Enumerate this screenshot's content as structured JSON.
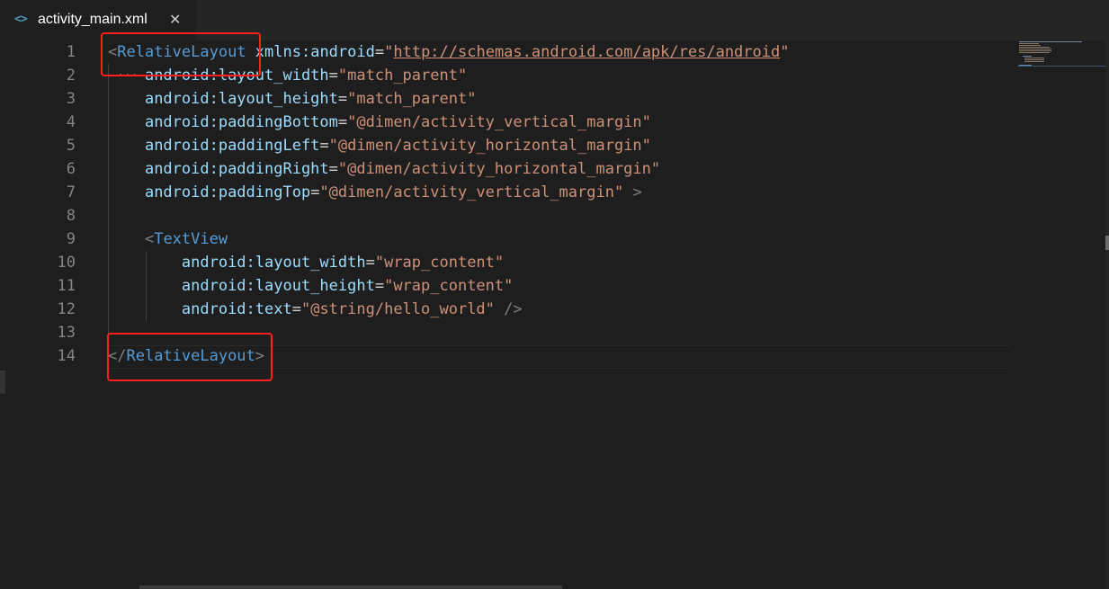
{
  "tab": {
    "icon": "xml-code-icon",
    "icon_glyph": "<>",
    "title": "activity_main.xml",
    "close_glyph": "✕"
  },
  "lines": [
    {
      "num": "1",
      "tokens": [
        [
          "br",
          "<"
        ],
        [
          "tag",
          "RelativeLayout"
        ],
        [
          "eq",
          " "
        ],
        [
          "attr",
          "xmlns:android"
        ],
        [
          "eq",
          "="
        ],
        [
          "str",
          "\""
        ],
        [
          "url",
          "http://schemas.android.com/apk/res/android"
        ],
        [
          "str",
          "\""
        ]
      ]
    },
    {
      "num": "2",
      "tokens": [
        [
          "eq",
          "    "
        ],
        [
          "attr",
          "android:layout_width"
        ],
        [
          "eq",
          "="
        ],
        [
          "str",
          "\"match_parent\""
        ]
      ]
    },
    {
      "num": "3",
      "tokens": [
        [
          "eq",
          "    "
        ],
        [
          "attr",
          "android:layout_height"
        ],
        [
          "eq",
          "="
        ],
        [
          "str",
          "\"match_parent\""
        ]
      ]
    },
    {
      "num": "4",
      "tokens": [
        [
          "eq",
          "    "
        ],
        [
          "attr",
          "android:paddingBottom"
        ],
        [
          "eq",
          "="
        ],
        [
          "str",
          "\"@dimen/activity_vertical_margin\""
        ]
      ]
    },
    {
      "num": "5",
      "tokens": [
        [
          "eq",
          "    "
        ],
        [
          "attr",
          "android:paddingLeft"
        ],
        [
          "eq",
          "="
        ],
        [
          "str",
          "\"@dimen/activity_horizontal_margin\""
        ]
      ]
    },
    {
      "num": "6",
      "tokens": [
        [
          "eq",
          "    "
        ],
        [
          "attr",
          "android:paddingRight"
        ],
        [
          "eq",
          "="
        ],
        [
          "str",
          "\"@dimen/activity_horizontal_margin\""
        ]
      ]
    },
    {
      "num": "7",
      "tokens": [
        [
          "eq",
          "    "
        ],
        [
          "attr",
          "android:paddingTop"
        ],
        [
          "eq",
          "="
        ],
        [
          "str",
          "\"@dimen/activity_vertical_margin\""
        ],
        [
          "eq",
          " "
        ],
        [
          "br",
          ">"
        ]
      ]
    },
    {
      "num": "8",
      "tokens": []
    },
    {
      "num": "9",
      "tokens": [
        [
          "eq",
          "    "
        ],
        [
          "br",
          "<"
        ],
        [
          "tag",
          "TextView"
        ]
      ]
    },
    {
      "num": "10",
      "tokens": [
        [
          "eq",
          "        "
        ],
        [
          "attr",
          "android:layout_width"
        ],
        [
          "eq",
          "="
        ],
        [
          "str",
          "\"wrap_content\""
        ]
      ]
    },
    {
      "num": "11",
      "tokens": [
        [
          "eq",
          "        "
        ],
        [
          "attr",
          "android:layout_height"
        ],
        [
          "eq",
          "="
        ],
        [
          "str",
          "\"wrap_content\""
        ]
      ]
    },
    {
      "num": "12",
      "tokens": [
        [
          "eq",
          "        "
        ],
        [
          "attr",
          "android:text"
        ],
        [
          "eq",
          "="
        ],
        [
          "str",
          "\"@string/hello_world\""
        ],
        [
          "eq",
          " "
        ],
        [
          "br",
          "/>"
        ]
      ]
    },
    {
      "num": "13",
      "tokens": []
    },
    {
      "num": "14",
      "tokens": [
        [
          "br",
          "</"
        ],
        [
          "tag",
          "RelativeLayout"
        ],
        [
          "br",
          ">"
        ]
      ]
    }
  ],
  "dots": "...",
  "colors": {
    "background": "#1e1e1e",
    "tag": "#569cd6",
    "attribute": "#9cdcfe",
    "string": "#ce9178",
    "highlight_box": "#ff1f1f"
  }
}
